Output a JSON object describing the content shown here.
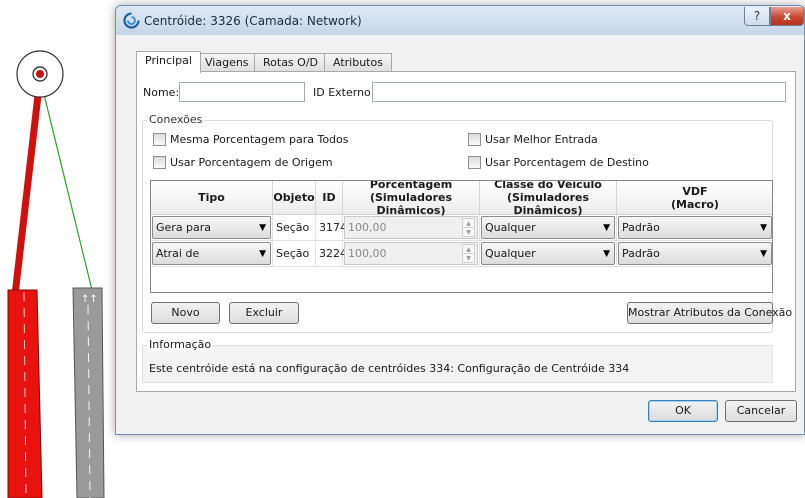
{
  "dialog": {
    "title": "Centróide: 3326 (Camada: Network)",
    "help_glyph": "?",
    "close_glyph": "x"
  },
  "tabs": [
    "Principal",
    "Viagens",
    "Rotas O/D",
    "Atributos"
  ],
  "active_tab": "Principal",
  "form": {
    "nome_label": "Nome:",
    "nome_value": "",
    "id_externo_label": "ID Externo:",
    "id_externo_value": ""
  },
  "conexoes": {
    "legend": "Conexões",
    "checkboxes": {
      "mesma_porcentagem": {
        "label": "Mesma Porcentagem para Todos",
        "checked": false
      },
      "usar_porcentagem_origem": {
        "label": "Usar Porcentagem de Origem",
        "checked": false
      },
      "usar_melhor_entrada": {
        "label": "Usar Melhor Entrada",
        "checked": false
      },
      "usar_porcentagem_destino": {
        "label": "Usar Porcentagem de Destino",
        "checked": false
      }
    },
    "table": {
      "headers": {
        "tipo": "Tipo",
        "objeto": "Objeto",
        "id": "ID",
        "porcentagem_1": "Porcentagem",
        "porcentagem_2": "(Simuladores Dinâmicos)",
        "classe_1": "Classe do Veículo",
        "classe_2": "(Simuladores Dinâmicos)",
        "vdf_1": "VDF",
        "vdf_2": "(Macro)"
      },
      "rows": [
        {
          "tipo": "Gera para",
          "objeto": "Seção",
          "id": "3174",
          "porcentagem": "100,00",
          "classe": "Qualquer",
          "vdf": "Padrão"
        },
        {
          "tipo": "Atrai de",
          "objeto": "Seção",
          "id": "3224",
          "porcentagem": "100,00",
          "classe": "Qualquer",
          "vdf": "Padrão"
        }
      ]
    },
    "buttons": {
      "novo": "Novo",
      "excluir": "Excluir",
      "mostrar_atributos": "Mostrar Atributos da Conexão"
    }
  },
  "informacao": {
    "legend": "Informação",
    "text": "Este centróide está na configuração de centróides 334: Configuração de Centróide 334"
  },
  "footer": {
    "ok": "OK",
    "cancelar": "Cancelar"
  },
  "map": {
    "road_marking": "↑↑",
    "colors": {
      "red_section": "#e8120f",
      "gray_section": "#9a9a9a",
      "connector": "#2e9e2e"
    }
  },
  "icons": {
    "arrow_down": "▼",
    "spin_up": "▲",
    "spin_down": "▼"
  }
}
